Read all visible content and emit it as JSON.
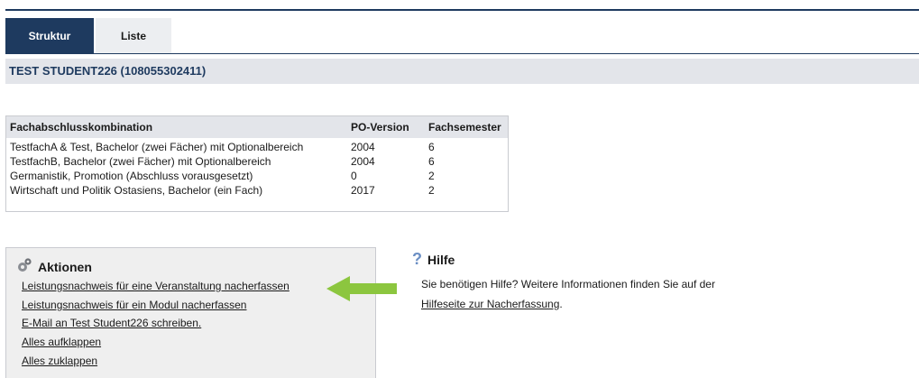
{
  "tabs": [
    {
      "label": "Struktur",
      "active": true
    },
    {
      "label": "Liste",
      "active": false
    }
  ],
  "student": {
    "title": "TEST STUDENT226 (108055302411)"
  },
  "degrees": {
    "headers": [
      "Fachabschlusskombination",
      "PO-Version",
      "Fachsemester"
    ],
    "rows": [
      [
        "TestfachA & Test, Bachelor (zwei Fächer) mit Optionalbereich",
        "2004",
        "6"
      ],
      [
        "TestfachB, Bachelor (zwei Fächer) mit Optionalbereich",
        "2004",
        "6"
      ],
      [
        "Germanistik, Promotion (Abschluss vorausgesetzt)",
        "0",
        "2"
      ],
      [
        "Wirtschaft und Politik Ostasiens, Bachelor (ein Fach)",
        "2017",
        "2"
      ]
    ]
  },
  "actions": {
    "title": "Aktionen",
    "icon": "gear-icon",
    "links": [
      "Leistungsnachweis für eine Veranstaltung nacherfassen",
      "Leistungsnachweis für ein Modul nacherfassen",
      "E-Mail an Test Student226 schreiben.",
      "Alles aufklappen",
      "Alles zuklappen"
    ]
  },
  "help": {
    "title": "Hilfe",
    "icon": "question-icon",
    "text": "Sie benötigen Hilfe? Weitere Informationen finden Sie auf der",
    "link": "Hilfeseite zur Nacherfassung",
    "link_suffix": "."
  },
  "colors": {
    "accent": "#1e3a5f",
    "arrow": "#8cc63f",
    "panel": "#efefef"
  }
}
